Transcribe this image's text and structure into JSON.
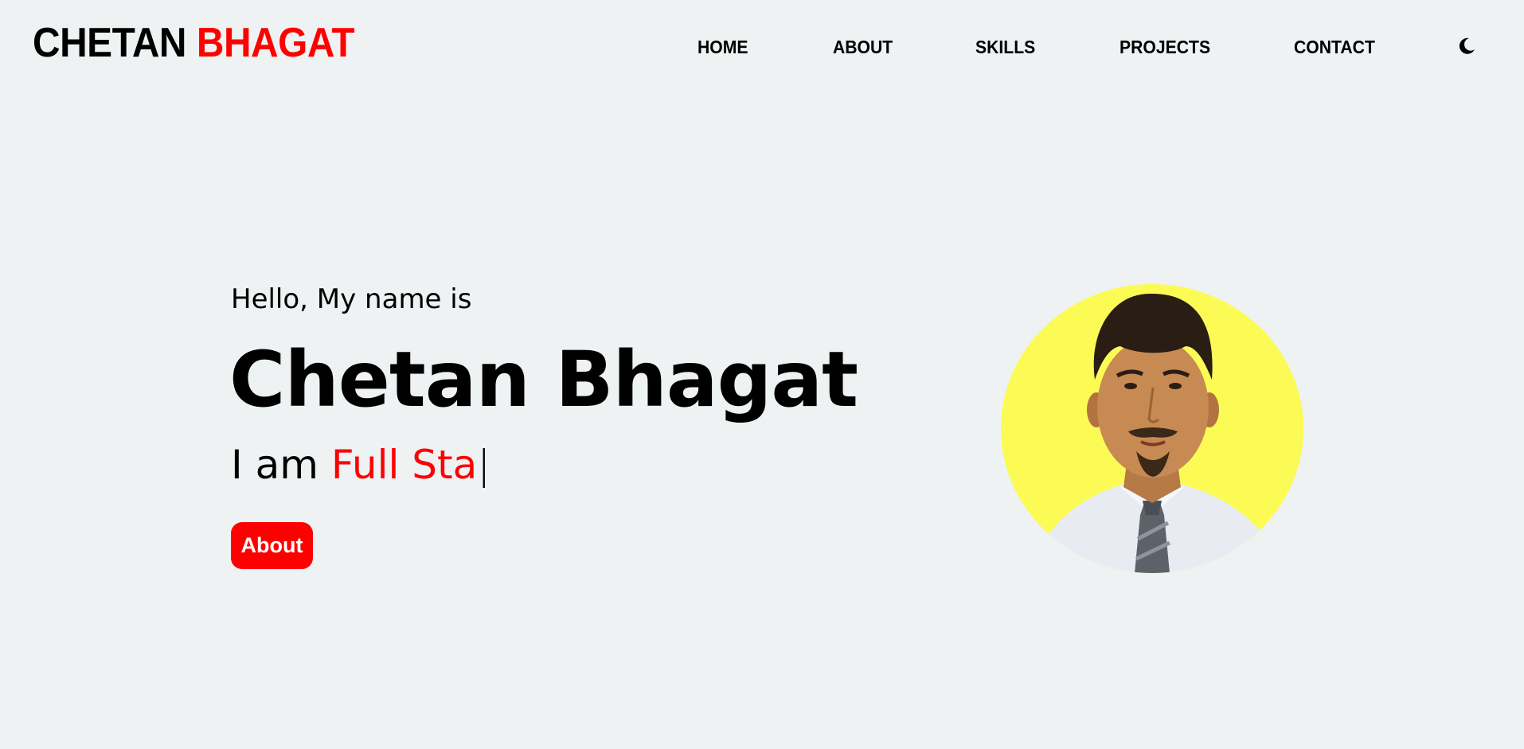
{
  "brand": {
    "first": "CHETAN",
    "second": "BHAGAT",
    "accent_color": "#ff0000"
  },
  "nav": {
    "links": [
      {
        "label": "HOME"
      },
      {
        "label": "ABOUT"
      },
      {
        "label": "SKILLS"
      },
      {
        "label": "PROJECTS"
      },
      {
        "label": "CONTACT"
      }
    ],
    "theme_toggle_icon": "moon-icon"
  },
  "hero": {
    "greeting": "Hello, My name is",
    "name": "Chetan Bhagat",
    "typing_prefix": "I am",
    "typing_text": "Full Sta",
    "cursor": "|",
    "about_button_label": "About",
    "portrait_background": "#fcfb55"
  },
  "colors": {
    "background": "#eef2f3",
    "accent": "#ff0000",
    "text": "#000000"
  }
}
